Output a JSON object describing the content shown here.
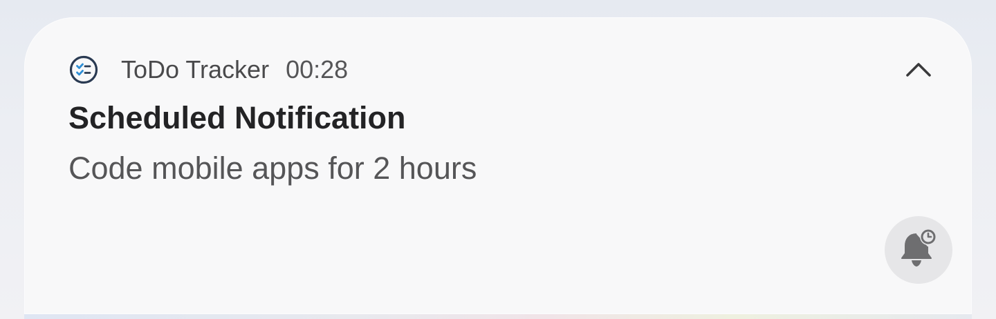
{
  "notification": {
    "app_name": "ToDo Tracker",
    "time": "00:28",
    "title": "Scheduled Notification",
    "body": "Code mobile apps for 2 hours",
    "app_icon": "checklist-icon",
    "collapse_icon": "chevron-up-icon",
    "snooze_icon": "bell-snooze-icon"
  },
  "colors": {
    "app_icon_accent": "#2f8fd6",
    "app_icon_outline": "#2a3a52"
  }
}
